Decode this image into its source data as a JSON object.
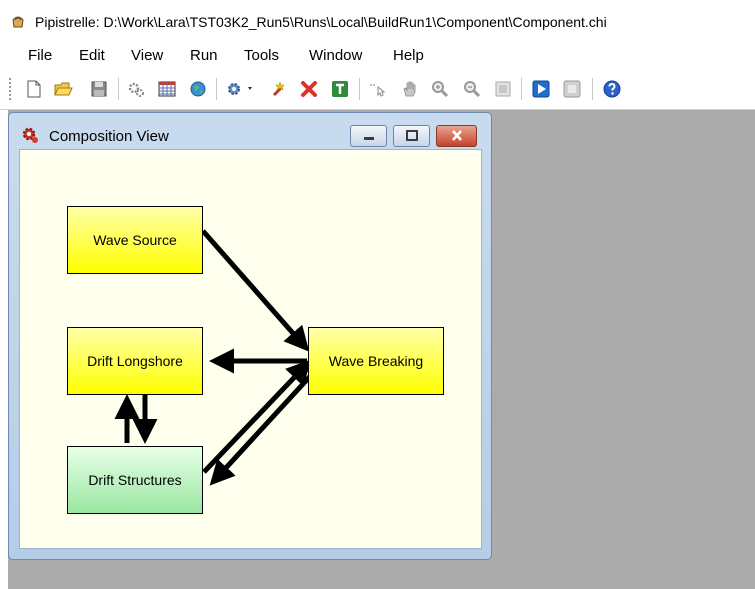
{
  "app": {
    "title": "Pipistrelle: D:\\Work\\Lara\\TST03K2_Run5\\Runs\\Local\\BuildRun1\\Component\\Component.chi"
  },
  "menu": {
    "items": [
      "File",
      "Edit",
      "View",
      "Run",
      "Tools",
      "Window",
      "Help"
    ]
  },
  "toolbar": {
    "icons": [
      "new-file-icon",
      "open-folder-icon",
      "save-icon",
      "gears-icon",
      "table-icon",
      "globe-icon",
      "settings-dropdown-icon",
      "add-link-icon",
      "delete-icon",
      "text-icon",
      "pointer-icon",
      "hand-icon",
      "zoom-in-icon",
      "zoom-out-icon",
      "fit-icon",
      "play-icon",
      "stop-icon",
      "help-icon"
    ]
  },
  "child_window": {
    "title": "Composition View"
  },
  "diagram": {
    "nodes": {
      "wave_source": "Wave Source",
      "drift_longshore": "Drift Longshore",
      "drift_structures": "Drift Structures",
      "wave_breaking": "Wave Breaking"
    },
    "colors": {
      "yellow_node": "#ffff00",
      "green_node": "#98e6a0",
      "canvas": "#ffffee"
    }
  }
}
